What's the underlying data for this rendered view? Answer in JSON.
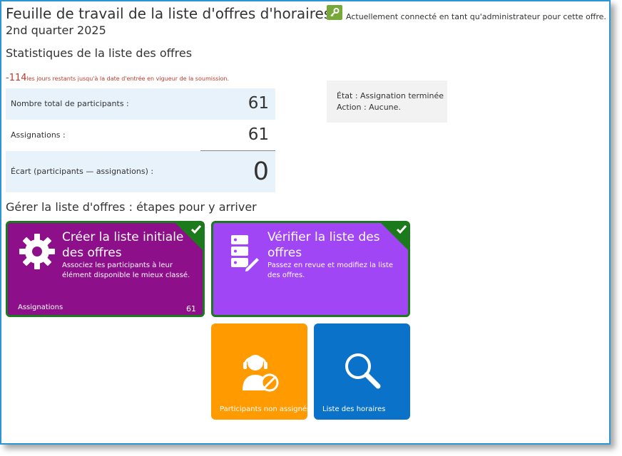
{
  "header": {
    "title": "Feuille de travail de la liste d'offres d'horaires",
    "subtitle": "2nd quarter 2025",
    "admin_note": "Actuellement connecté en tant qu'administrateur pour cette offre."
  },
  "stats": {
    "heading": "Statistiques de la liste des offres",
    "days_number": "-114",
    "days_text": "les jours restants jusqu'à la date d'entrée en vigueur de la soumission.",
    "rows": [
      {
        "label": "Nombre total de participants :",
        "value": "61"
      },
      {
        "label": "Assignations :",
        "value": "61"
      },
      {
        "label": "Écart (participants — assignations) :",
        "value": "0"
      }
    ]
  },
  "status": {
    "state_label": "État :",
    "state_value": "Assignation terminée",
    "action_label": "Action :",
    "action_value": "Aucune."
  },
  "manage": {
    "heading": "Gérer la liste d'offres : étapes pour y arriver",
    "tiles": [
      {
        "title": "Créer la liste initiale des offres",
        "desc": "Associez les participants à leur élément disponible le mieux classé.",
        "footer": "Assignations",
        "count": "61",
        "icon": "gear-icon",
        "color": "#8e0f8a"
      },
      {
        "title": "Vérifier la liste des offres",
        "desc": "Passez en revue et modifiez la liste des offres.",
        "icon": "list-edit-icon",
        "color": "#a046f5"
      },
      {
        "label": "Participants non assignés",
        "icon": "headset-user-blocked-icon",
        "color": "#ff9a00"
      },
      {
        "label": "Liste des horaires",
        "icon": "magnifier-icon",
        "color": "#0b72c9"
      }
    ]
  },
  "colors": {
    "accent_border": "#2b95d6",
    "complete_green": "#1b7a1b"
  }
}
